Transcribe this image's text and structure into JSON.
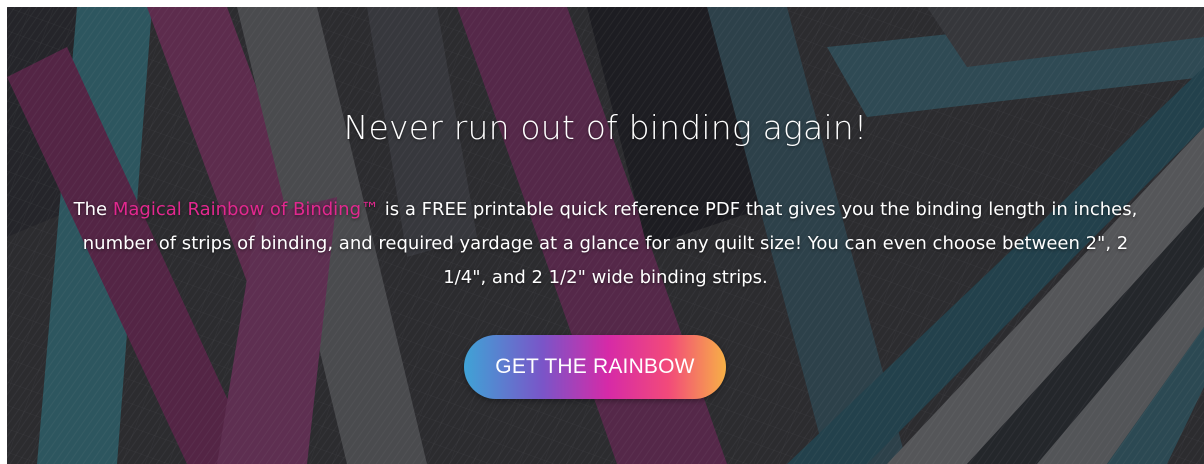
{
  "hero": {
    "headline": "Never run out of binding again!",
    "body_prefix": "The ",
    "brand_name": "Magical Rainbow of Binding™",
    "body_rest": " is a FREE printable quick reference PDF that gives you the binding length in inches, number of strips of binding, and required yardage at a glance for any quilt size! You can even choose between 2\", 2 1/4\", and 2 1/2\" wide binding strips.",
    "cta_label": "GET THE RAINBOW"
  },
  "colors": {
    "brand_text": "#e2288f",
    "cta_gradient_start": "#3fa3d6",
    "cta_gradient_mid": "#d62aa7",
    "cta_gradient_end": "#f7b046",
    "text": "#ffffff"
  }
}
